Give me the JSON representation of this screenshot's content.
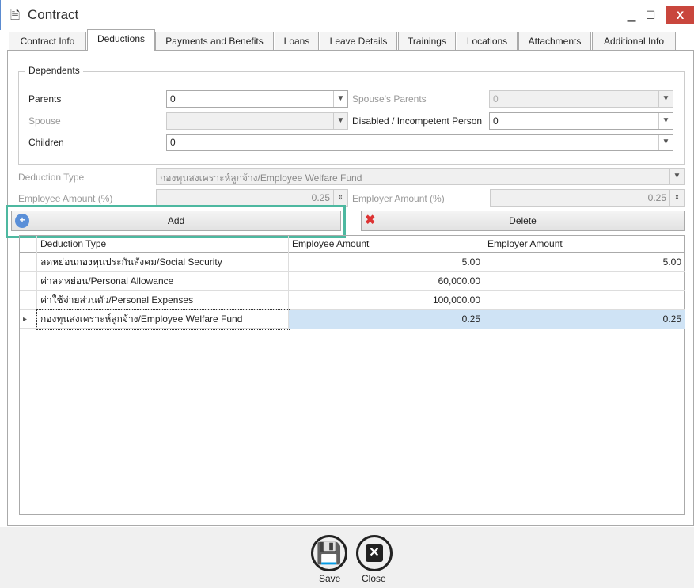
{
  "window": {
    "title": "Contract"
  },
  "tabs": [
    "Contract Info",
    "Deductions",
    "Payments and Benefits",
    "Loans",
    "Leave Details",
    "Trainings",
    "Locations",
    "Attachments",
    "Additional Info"
  ],
  "active_tab": "Deductions",
  "dependents": {
    "legend": "Dependents",
    "parents_label": "Parents",
    "parents_value": "0",
    "spouse_parents_label": "Spouse's Parents",
    "spouse_parents_value": "0",
    "spouse_label": "Spouse",
    "spouse_value": "",
    "disabled_label": "Disabled / Incompetent Person",
    "disabled_value": "0",
    "children_label": "Children",
    "children_value": "0"
  },
  "deduction": {
    "type_label": "Deduction Type",
    "type_value": "กองทุนสงเคราะห์ลูกจ้าง/Employee Welfare Fund",
    "employee_label": "Employee Amount (%)",
    "employee_value": "0.25",
    "employer_label": "Employer Amount (%)",
    "employer_value": "0.25"
  },
  "buttons": {
    "add": "Add",
    "delete": "Delete",
    "save": "Save",
    "close": "Close"
  },
  "grid": {
    "columns": [
      "Deduction Type",
      "Employee Amount",
      "Employer Amount"
    ],
    "rows": [
      [
        "ลดหย่อนกองทุนประกันสังคม/Social Security",
        "5.00",
        "5.00"
      ],
      [
        "ค่าลดหย่อน/Personal Allowance",
        "60,000.00",
        ""
      ],
      [
        "ค่าใช้จ่ายส่วนตัว/Personal Expenses",
        "100,000.00",
        ""
      ],
      [
        "กองทุนสงเคราะห์ลูกจ้าง/Employee Welfare Fund",
        "0.25",
        "0.25"
      ]
    ]
  },
  "colors": {
    "highlight": "#4db8a0",
    "selected_row": "#cfe3f5",
    "close_button": "#c9463d"
  }
}
